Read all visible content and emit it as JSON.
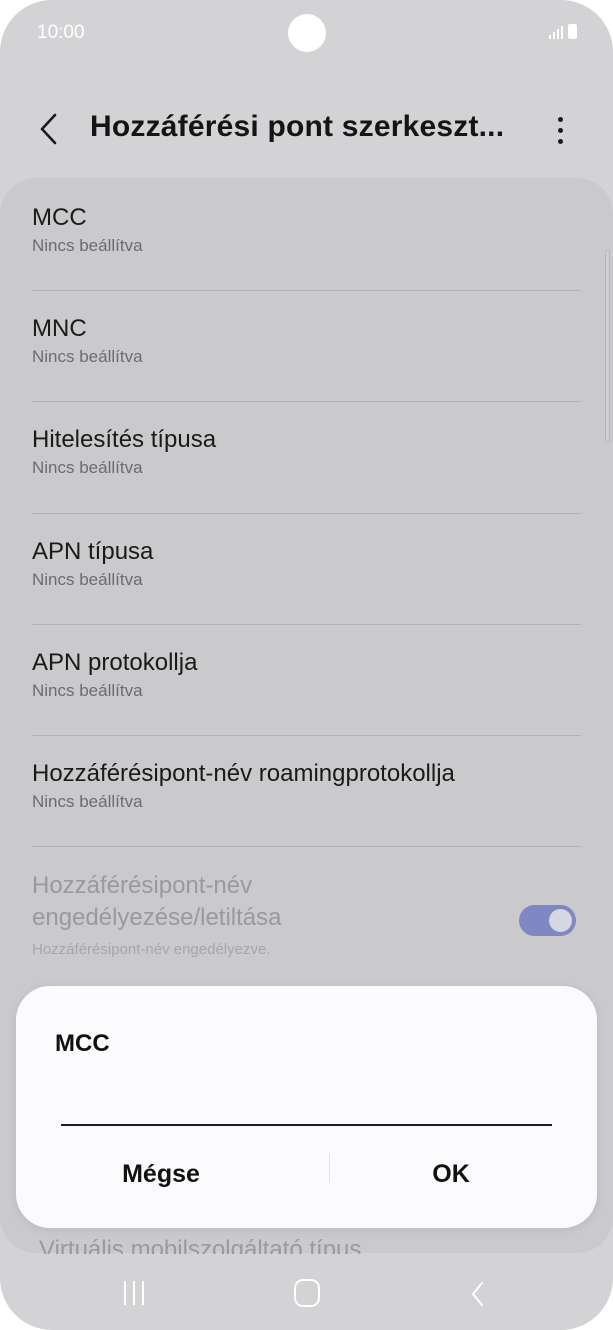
{
  "status_bar": {
    "time": "10:00"
  },
  "header": {
    "title": "Hozzáférési pont szerkeszt...",
    "back_icon": "chevron-left-icon",
    "more_icon": "more-vertical-icon"
  },
  "list": {
    "items": [
      {
        "title": "MCC",
        "subtitle": "Nincs beállítva"
      },
      {
        "title": "MNC",
        "subtitle": "Nincs beállítva"
      },
      {
        "title": "Hitelesítés típusa",
        "subtitle": "Nincs beállítva"
      },
      {
        "title": "APN típusa",
        "subtitle": "Nincs beállítva"
      },
      {
        "title": "APN protokollja",
        "subtitle": "Nincs beállítva"
      },
      {
        "title": "Hozzáférésipont-név roamingprotokollja",
        "subtitle": "Nincs beállítva"
      }
    ],
    "toggle_item": {
      "title_line1": "Hozzáférésipont-név",
      "title_line2": "engedélyezése/letiltása",
      "subtitle": "Hozzáférésipont-név engedélyezve.",
      "enabled": true
    }
  },
  "dialog": {
    "title": "MCC",
    "input_value": "",
    "cancel_label": "Mégse",
    "ok_label": "OK"
  },
  "colors": {
    "toggle_on": "#7f88c3",
    "dim_background": "#d3d3d6",
    "dialog_background": "#fbfbfd"
  },
  "nav_bar": {
    "recent_icon": "recent-apps-icon",
    "home_icon": "home-icon",
    "back_icon": "back-icon"
  }
}
